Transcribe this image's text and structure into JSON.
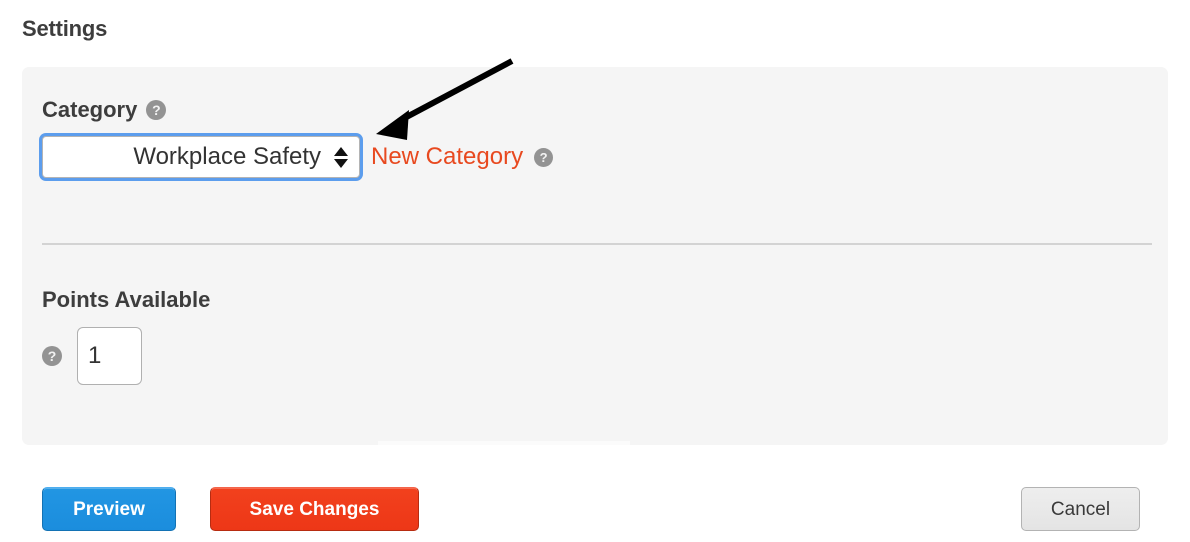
{
  "page": {
    "title": "Settings",
    "background_color": "#ffffff"
  },
  "panel": {
    "background_color": "#f5f5f5"
  },
  "category": {
    "label": "Category",
    "help_icon": "question-mark-circle-icon",
    "select": {
      "value": "Workplace Safety",
      "stepper_icon": "up-down-triangles-icon",
      "focused": true,
      "focus_ring_color": "#5c9ded",
      "options": [
        "Workplace Safety"
      ]
    },
    "new_category_link": {
      "label": "New Category",
      "color": "#e8491f"
    },
    "new_category_help_icon": "question-mark-circle-icon"
  },
  "points": {
    "label": "Points Available",
    "help_icon": "question-mark-circle-icon",
    "input": {
      "value": "1",
      "placeholder": ""
    }
  },
  "annotation": {
    "arrow_icon": "arrow-pointing-down-left-icon",
    "color": "#000000"
  },
  "footer": {
    "preview_label": "Preview",
    "preview_color": "#1b8ddd",
    "save_label": "Save Changes",
    "save_color": "#ed3717",
    "cancel_label": "Cancel",
    "cancel_color": "#e4e4e4"
  }
}
